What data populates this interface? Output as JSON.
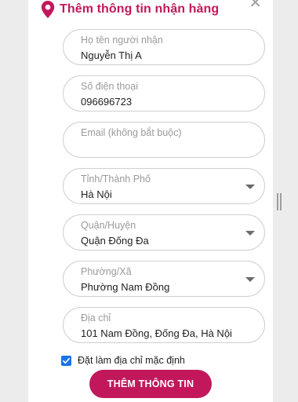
{
  "header": {
    "title": "Thêm thông tin nhận hàng",
    "pin_icon": "location-pin-icon",
    "close_icon": "close-icon",
    "accent_color": "#c2185b"
  },
  "form": {
    "recipient_name": {
      "label": "Họ tên người nhận",
      "value": "Nguyễn Thị A"
    },
    "phone": {
      "label": "Số điện thoại",
      "value": "096696723"
    },
    "email": {
      "label": "Email (không bắt buộc)",
      "value": ""
    },
    "province": {
      "label": "Tỉnh/Thành Phố",
      "value": "Hà Nội"
    },
    "district": {
      "label": "Quận/Huyện",
      "value": "Quận Đống Đa"
    },
    "ward": {
      "label": "Phường/Xã",
      "value": "Phường Nam Đồng"
    },
    "address": {
      "label": "Địa chỉ",
      "value": "101 Nam Đồng, Đống Đa, Hà Nội"
    },
    "default_checkbox": {
      "label": "Đặt làm địa chỉ mặc định",
      "checked": true,
      "color": "#1a73e8"
    },
    "submit_label": "THÊM THÔNG TIN"
  }
}
